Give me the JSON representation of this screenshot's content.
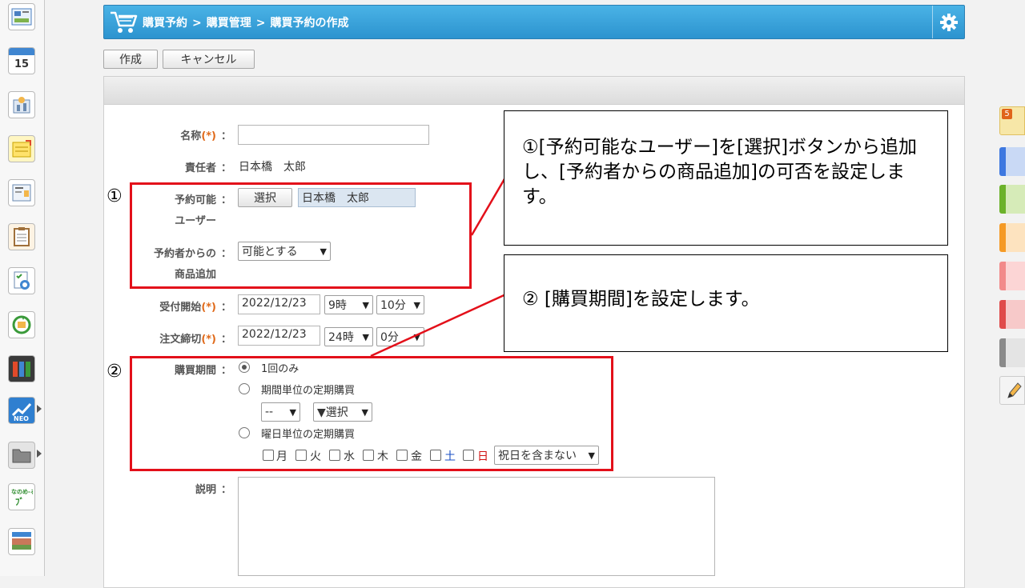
{
  "header": {
    "breadcrumb": [
      "購買予約",
      "購買管理",
      "購買予約の作成"
    ],
    "separator": ">"
  },
  "toolbar": {
    "create_label": "作成",
    "cancel_label": "キャンセル"
  },
  "leftbar": {
    "calendar_day": "15",
    "items": [
      "portal-icon",
      "schedule-icon",
      "facility-icon",
      "memo-icon",
      "bulletin-icon",
      "report-icon",
      "survey-icon",
      "workflow-icon",
      "cabinet-icon",
      "neo-icon",
      "folder-icon",
      "nanomail-icon",
      "news-icon"
    ]
  },
  "form": {
    "name": {
      "label": "名称",
      "req": "(*)",
      "value": ""
    },
    "owner": {
      "label": "責任者",
      "value": "日本橋　太郎"
    },
    "users": {
      "label_line1": "予約可能",
      "label_line2": "ユーザー",
      "select_label": "選択",
      "value": "日本橋　太郎"
    },
    "add_item": {
      "label_line1": "予約者からの",
      "label_line2": "商品追加",
      "value": "可能とする"
    },
    "start": {
      "label": "受付開始",
      "req": "(*)",
      "date": "2022/12/23",
      "hour": "9時",
      "minute": "10分"
    },
    "deadline": {
      "label": "注文締切",
      "req": "(*)",
      "date": "2022/12/23",
      "hour": "24時",
      "minute": "0分"
    },
    "period": {
      "label": "購買期間",
      "opt1": "1回のみ",
      "opt2": "期間単位の定期購買",
      "interval": "--",
      "unit": "▼選択",
      "opt3": "曜日単位の定期購買",
      "days": [
        "月",
        "火",
        "水",
        "木",
        "金",
        "土",
        "日"
      ],
      "holiday": "祝日を含まない"
    },
    "desc": {
      "label": "説明"
    },
    "colon": "："
  },
  "annotations": {
    "marker1": "①",
    "marker2": "②",
    "callout1": "①[予約可能なユーザー]を[選択]ボタンから追加し、[予約者からの商品追加]の可否を設定します。",
    "callout2": "② [購買期間]を設定します。"
  },
  "colors": {
    "header": "#2c93cf",
    "highlight": "#e3101a",
    "required": "#e06a1a",
    "saturday": "#1a4fc4",
    "sunday": "#d01010"
  }
}
